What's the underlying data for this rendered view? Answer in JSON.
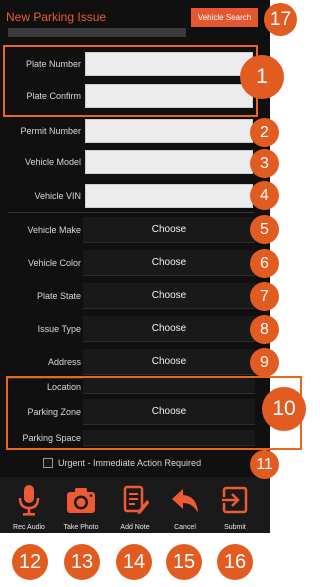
{
  "header": {
    "title": "New Parking Issue",
    "vehicle_search_label": "Vehicle Search"
  },
  "fields": {
    "plate_number": {
      "label": "Plate Number",
      "value": ""
    },
    "plate_confirm": {
      "label": "Plate Confirm",
      "value": ""
    },
    "permit_number": {
      "label": "Permit Number",
      "value": ""
    },
    "vehicle_model": {
      "label": "Vehicle Model",
      "value": ""
    },
    "vehicle_vin": {
      "label": "Vehicle VIN",
      "value": ""
    }
  },
  "selects": {
    "vehicle_make": {
      "label": "Vehicle Make",
      "value": "Choose"
    },
    "vehicle_color": {
      "label": "Vehicle Color",
      "value": "Choose"
    },
    "plate_state": {
      "label": "Plate State",
      "value": "Choose"
    },
    "issue_type": {
      "label": "Issue Type",
      "value": "Choose"
    },
    "address": {
      "label": "Address",
      "value": "Choose"
    },
    "parking_zone": {
      "label": "Parking Zone",
      "value": "Choose"
    }
  },
  "location": {
    "location_label": "Location",
    "parking_space_label": "Parking Space"
  },
  "urgent": {
    "label": "Urgent - Immediate Action Required",
    "checked": false
  },
  "actions": {
    "rec_audio": "Rec Audio",
    "take_photo": "Take Photo",
    "add_note": "Add Note",
    "cancel": "Cancel",
    "submit": "Submit"
  },
  "icons": {
    "rec_audio": "microphone-icon",
    "take_photo": "camera-icon",
    "add_note": "note-pencil-icon",
    "cancel": "back-arrow-icon",
    "submit": "enter-icon"
  },
  "callouts": [
    "1",
    "2",
    "3",
    "4",
    "5",
    "6",
    "7",
    "8",
    "9",
    "10",
    "11",
    "12",
    "13",
    "14",
    "15",
    "16",
    "17"
  ],
  "colors": {
    "accent": "#e5572f",
    "callout": "#e25c22",
    "background": "#101010",
    "field": "#ececec"
  }
}
